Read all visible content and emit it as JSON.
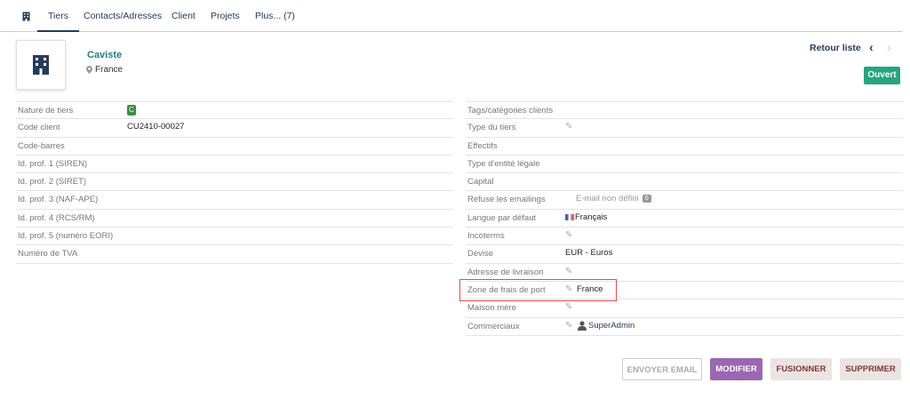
{
  "tabs": [
    {
      "label": "Tiers"
    },
    {
      "label": "Contacts/Adresses"
    },
    {
      "label": "Client"
    },
    {
      "label": "Projets"
    },
    {
      "label": "Plus... (7)"
    }
  ],
  "header": {
    "name": "Caviste",
    "country": "France",
    "retour": "Retour liste",
    "prev": "‹",
    "next": "›",
    "status": "Ouvert"
  },
  "left_fields": [
    {
      "label": "Nature de tiers",
      "value": "C"
    },
    {
      "label": "Code client",
      "value": "CU2410-00027"
    },
    {
      "label": "Code-barres",
      "value": ""
    },
    {
      "label": "Id. prof. 1 (SIREN)",
      "value": ""
    },
    {
      "label": "Id. prof. 2 (SIRET)",
      "value": ""
    },
    {
      "label": "Id. prof. 3 (NAF-APE)",
      "value": ""
    },
    {
      "label": "Id. prof. 4 (RCS/RM)",
      "value": ""
    },
    {
      "label": "Id. prof. 5 (numéro EORI)",
      "value": ""
    },
    {
      "label": "Numéro de TVA",
      "value": ""
    }
  ],
  "right_fields": [
    {
      "label": "Tags/catégories clients",
      "value": ""
    },
    {
      "label": "Type du tiers",
      "value": ""
    },
    {
      "label": "Effectifs",
      "value": ""
    },
    {
      "label": "Type d'entité légale",
      "value": ""
    },
    {
      "label": "Capital",
      "value": ""
    },
    {
      "label": "Refuse les emailings",
      "value": "E-mail non défini",
      "badge": "0"
    },
    {
      "label": "Langue par défaut",
      "value": "Français"
    },
    {
      "label": "Incoterms",
      "value": ""
    },
    {
      "label": "Devise",
      "value": "EUR - Euros"
    },
    {
      "label": "Adresse de livraison",
      "value": ""
    },
    {
      "label": "Zone de frais de port",
      "value": "France"
    },
    {
      "label": "Maison mère",
      "value": ""
    },
    {
      "label": "Commerciaux",
      "value": "SuperAdmin"
    }
  ],
  "buttons": {
    "email": "ENVOYER EMAIL",
    "modifier": "MODIFIER",
    "fusionner": "FUSIONNER",
    "supprimer": "SUPPRIMER"
  },
  "colors": {
    "accent": "#263c5c",
    "company": "#1e7f87",
    "status": "#25a580",
    "modifier": "#9a67b0",
    "highlight": "#e84b4b"
  },
  "icons": {
    "building": "building-icon",
    "location": "map-marker-icon",
    "pencil": "pencil-icon",
    "user": "user-icon"
  }
}
